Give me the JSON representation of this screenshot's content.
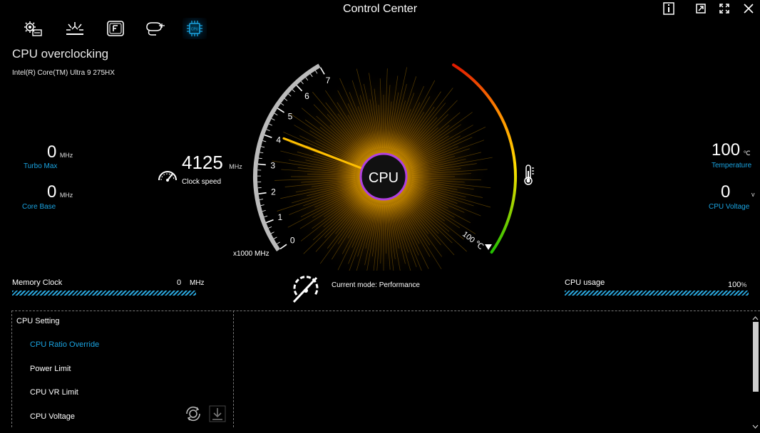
{
  "window": {
    "title": "Control Center"
  },
  "window_buttons": [
    {
      "name": "info-button",
      "icon": "info-icon"
    },
    {
      "name": "restore-button",
      "icon": "restore-icon"
    },
    {
      "name": "fullscreen-button",
      "icon": "fullscreen-icon"
    },
    {
      "name": "close-button",
      "icon": "close-icon"
    }
  ],
  "tabs": [
    {
      "name": "tab-settings",
      "icon": "gear-settings-icon"
    },
    {
      "name": "tab-lighting",
      "icon": "lighting-icon"
    },
    {
      "name": "tab-fn-keys",
      "icon": "f-key-icon"
    },
    {
      "name": "tab-devices",
      "icon": "mouse-device-icon"
    },
    {
      "name": "tab-cpu",
      "icon": "cpu-chip-icon",
      "active": true
    }
  ],
  "page": {
    "title": "CPU overclocking",
    "cpu_model": "Intel(R) Core(TM) Ultra 9 275HX"
  },
  "left_stats": {
    "turbo_max": {
      "value": "0",
      "unit": "MHz",
      "label": "Turbo Max"
    },
    "core_base": {
      "value": "0",
      "unit": "MHz",
      "label": "Core Base"
    }
  },
  "clock": {
    "value": "4125",
    "unit": "MHz",
    "label": "Clock speed"
  },
  "gauge": {
    "ticks": [
      "0",
      "1",
      "2",
      "3",
      "4",
      "5",
      "6",
      "7"
    ],
    "scale_label": "x1000 MHz",
    "center_label": "CPU",
    "temp_marker": "100 ℃",
    "needle_value": 4.125,
    "temp_fraction": 1.0
  },
  "right_stats": {
    "temperature": {
      "value": "100",
      "unit": "℃",
      "label": "Temperature"
    },
    "cpu_voltage": {
      "value": "0",
      "unit": "v",
      "label": "CPU Voltage"
    }
  },
  "memory_clock": {
    "label": "Memory Clock",
    "value": "0",
    "unit": "MHz",
    "fill": 0.0
  },
  "mode": {
    "text": "Current mode: Performance"
  },
  "cpu_usage": {
    "label": "CPU usage",
    "value": "100",
    "unit": "%",
    "fill": 1.0
  },
  "settings": {
    "title": "CPU Setting",
    "items": [
      "CPU Ratio Override",
      "Power Limit",
      "CPU VR Limit",
      "CPU Voltage"
    ],
    "active_index": 0
  },
  "colors": {
    "accent": "#1aa3e0",
    "gauge_glow": "#ffb300",
    "cpu_ring": "#b040e0"
  }
}
